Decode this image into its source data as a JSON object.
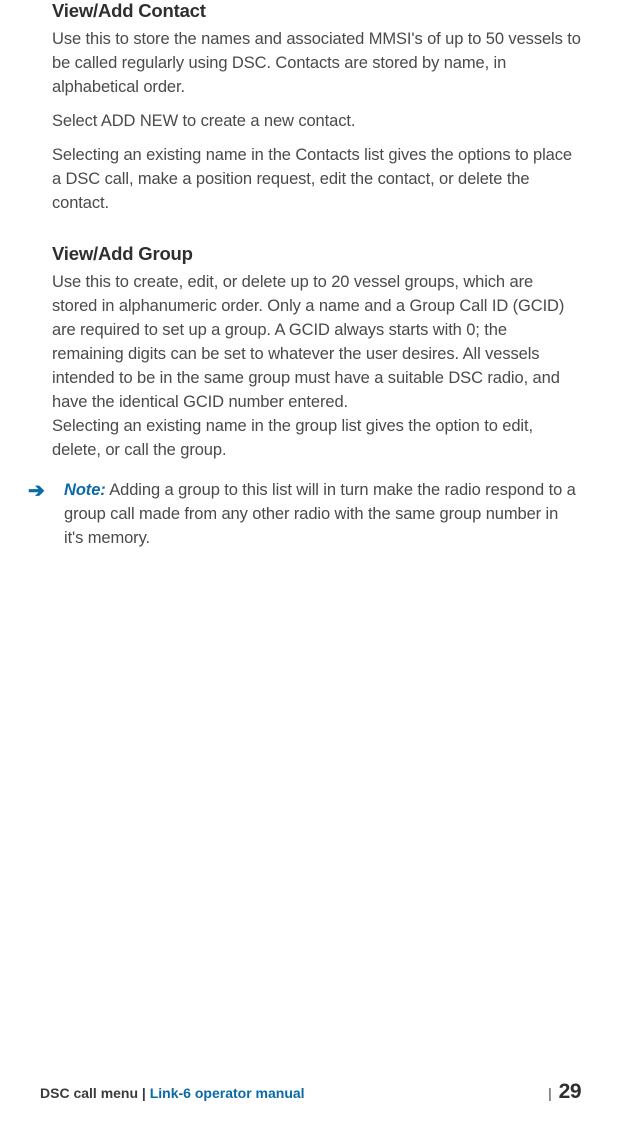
{
  "section1": {
    "heading": "View/Add Contact",
    "p1": "Use this to store the names and associated MMSI's of up to 50 vessels to be called regularly using DSC. Contacts are stored by name, in alphabetical order.",
    "p2": "Select ADD NEW to create a new contact.",
    "p3": "Selecting an existing name in the Contacts list gives the options to place a DSC call, make a position request, edit the contact, or delete the contact."
  },
  "section2": {
    "heading": "View/Add Group",
    "p1": "Use this to create, edit, or delete up to 20 vessel groups, which are stored in alphanumeric order. Only a name and a Group Call ID (GCID) are required to set up a group. A GCID always starts with 0; the remaining digits can be set to whatever the user desires. All vessels intended to be in the same group must have a suitable DSC radio, and have the identical GCID number entered.",
    "p2": "Selecting an existing name in the group list gives the option to edit, delete, or call the group."
  },
  "note": {
    "label": "Note:",
    "text": " Adding a group to this list will in turn make the radio respond to a group call made from any other radio with the same group number in it's memory."
  },
  "footer": {
    "section": "DSC call menu",
    "separator": " | ",
    "brand": "Link-6 operator manual",
    "page_pipe": "| ",
    "page_number": "29"
  }
}
